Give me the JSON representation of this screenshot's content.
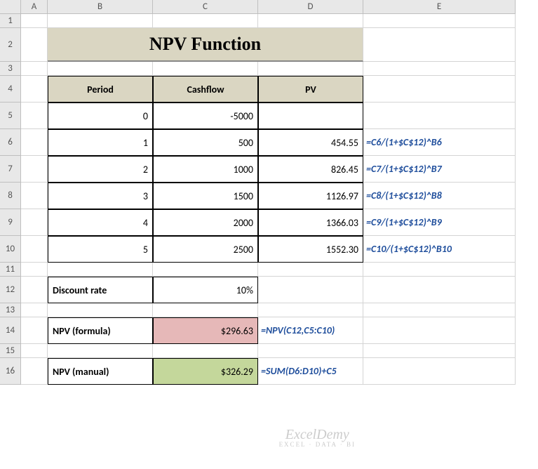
{
  "cols": [
    "A",
    "B",
    "C",
    "D",
    "E"
  ],
  "rows": [
    "1",
    "2",
    "3",
    "4",
    "5",
    "6",
    "7",
    "8",
    "9",
    "10",
    "11",
    "12",
    "13",
    "14",
    "15",
    "16"
  ],
  "title": "NPV Function",
  "headers": {
    "period": "Period",
    "cashflow": "Cashflow",
    "pv": "PV"
  },
  "data": [
    {
      "period": "0",
      "cashflow": "-5000",
      "pv": "",
      "formula": ""
    },
    {
      "period": "1",
      "cashflow": "500",
      "pv": "454.55",
      "formula": "=C6/(1+$C$12)^B6"
    },
    {
      "period": "2",
      "cashflow": "1000",
      "pv": "826.45",
      "formula": "=C7/(1+$C$12)^B7"
    },
    {
      "period": "3",
      "cashflow": "1500",
      "pv": "1126.97",
      "formula": "=C8/(1+$C$12)^B8"
    },
    {
      "period": "4",
      "cashflow": "2000",
      "pv": "1366.03",
      "formula": "=C9/(1+$C$12)^B9"
    },
    {
      "period": "5",
      "cashflow": "2500",
      "pv": "1552.30",
      "formula": "=C10/(1+$C$12)^B10"
    }
  ],
  "discount": {
    "label": "Discount rate",
    "value": "10%"
  },
  "npv_formula": {
    "label": "NPV (formula)",
    "value": "$296.63",
    "formula": "=NPV(C12,C5:C10)"
  },
  "npv_manual": {
    "label": "NPV (manual)",
    "value": "$326.29",
    "formula": "=SUM(D6:D10)+C5"
  },
  "watermark": {
    "main": "ExcelDemy",
    "sub": "EXCEL · DATA · BI"
  }
}
